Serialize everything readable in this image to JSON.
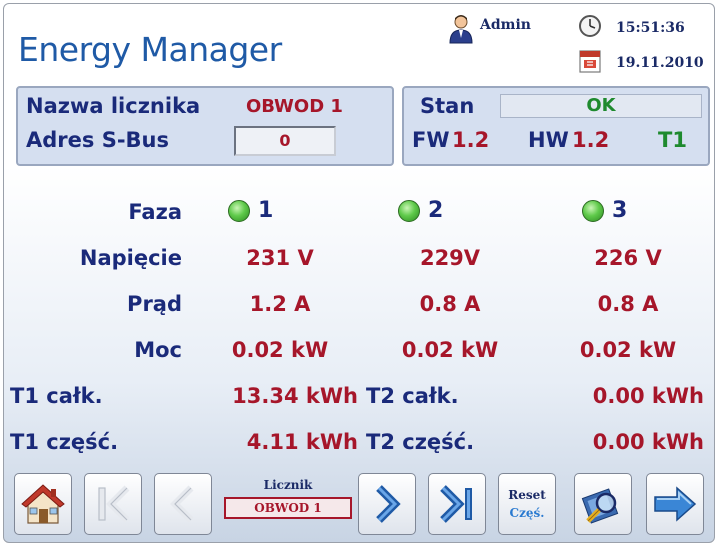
{
  "header": {
    "title": "Energy Manager",
    "user": "Admin",
    "time": "15:51:36",
    "date": "19.11.2010"
  },
  "meter_panel": {
    "name_label": "Nazwa licznika",
    "name_value": "OBWOD 1",
    "address_label": "Adres S-Bus",
    "address_value": "0"
  },
  "status_panel": {
    "state_label": "Stan",
    "state_value": "OK",
    "fw_label": "FW",
    "fw_value": "1.2",
    "hw_label": "HW",
    "hw_value": "1.2",
    "tariff": "T1"
  },
  "phases": {
    "label": "Faza",
    "items": [
      "1",
      "2",
      "3"
    ]
  },
  "rows": [
    {
      "label": "Napięcie",
      "values": [
        "231 V",
        "229V",
        "226 V"
      ]
    },
    {
      "label": "Prąd",
      "values": [
        "1.2 A",
        "0.8 A",
        "0.8 A"
      ]
    },
    {
      "label": "Moc",
      "values": [
        "0.02 kW",
        "0.02 kW",
        "0.02 kW"
      ]
    }
  ],
  "totals": {
    "t1_total_label": "T1 całk.",
    "t1_total_value": "13.34 kWh",
    "t2_total_label": "T2 całk.",
    "t2_total_value": "0.00 kWh",
    "t1_partial_label": "T1 część.",
    "t1_partial_value": "4.11 kWh",
    "t2_partial_label": "T2 część.",
    "t2_partial_value": "0.00 kWh"
  },
  "toolbar": {
    "meter_label": "Licznik",
    "meter_value": "OBWOD 1",
    "reset_line1": "Reset",
    "reset_line2": "Częś.",
    "icons": [
      "home-icon",
      "first-icon",
      "previous-icon",
      "next-icon",
      "last-icon",
      "search-icon",
      "forward-arrow-icon"
    ]
  },
  "colors": {
    "title": "#1f5aa6",
    "label": "#1a2a7a",
    "value": "#a6162a",
    "ok": "#1e8a2e",
    "panel": "#d5dff0"
  }
}
